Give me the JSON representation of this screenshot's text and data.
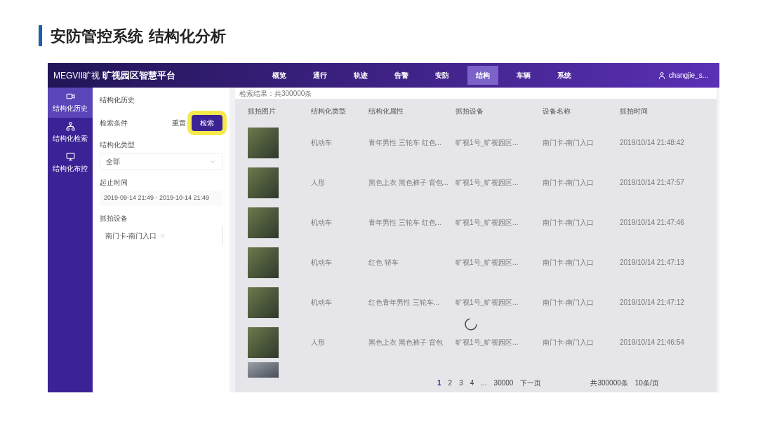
{
  "slide_title": "安防管控系统 结构化分析",
  "app": {
    "logo": "MEGVII旷视",
    "name": "旷视园区智慧平台",
    "user": "changjie_s...",
    "nav": [
      {
        "label": "概览",
        "selected": false
      },
      {
        "label": "通行",
        "selected": false
      },
      {
        "label": "轨迹",
        "selected": false
      },
      {
        "label": "告警",
        "selected": false
      },
      {
        "label": "安防",
        "selected": false
      },
      {
        "label": "结构",
        "selected": true
      },
      {
        "label": "车辆",
        "selected": false
      },
      {
        "label": "系统",
        "selected": false
      }
    ]
  },
  "sidebar": [
    {
      "label": "结构化历史",
      "selected": true
    },
    {
      "label": "结构化检索",
      "selected": false
    },
    {
      "label": "结构化布控",
      "selected": false
    }
  ],
  "filter": {
    "title": "结构化历史",
    "conditions_label": "检索条件",
    "reset": "重置",
    "search": "检索",
    "fields": [
      {
        "kind": "select",
        "label": "结构化类型",
        "value": "全部"
      },
      {
        "kind": "range",
        "label": "起止时间",
        "value": "2019-09-14 21:49 - 2019-10-14 21:49"
      },
      {
        "kind": "tags",
        "label": "抓拍设备",
        "value": "南门卡-南门入口"
      }
    ]
  },
  "results": {
    "summary": "检索结果：共300000条",
    "columns": [
      "抓拍图片",
      "结构化类型",
      "结构化属性",
      "抓拍设备",
      "设备名称",
      "抓拍时间"
    ],
    "rows": [
      {
        "type": "机动车",
        "attribute": "青年男性 三轮车 红色...",
        "location": "旷视1号_旷视园区...",
        "device": "南门卡-南门入口",
        "time": "2019/10/14 21:48:42"
      },
      {
        "type": "人形",
        "attribute": "黑色上衣 黑色裤子 背包...",
        "location": "旷视1号_旷视园区...",
        "device": "南门卡-南门入口",
        "time": "2019/10/14 21:47:57"
      },
      {
        "type": "机动车",
        "attribute": "青年男性 三轮车 红色...",
        "location": "旷视1号_旷视园区...",
        "device": "南门卡-南门入口",
        "time": "2019/10/14 21:47:46"
      },
      {
        "type": "机动车",
        "attribute": "红色 轿车",
        "location": "旷视1号_旷视园区...",
        "device": "南门卡-南门入口",
        "time": "2019/10/14 21:47:13"
      },
      {
        "type": "机动车",
        "attribute": "红色青年男性 三轮车...",
        "location": "旷视1号_旷视园区...",
        "device": "南门卡-南门入口",
        "time": "2019/10/14 21:47:12"
      },
      {
        "type": "人形",
        "attribute": "黑色上衣 黑色裤子 背包",
        "location": "旷视1号_旷视园区...",
        "device": "南门卡-南门入口",
        "time": "2019/10/14 21:46:54"
      }
    ],
    "pagination": {
      "pages": [
        {
          "label": "1",
          "selected": true
        },
        {
          "label": "2",
          "selected": false
        },
        {
          "label": "3",
          "selected": false
        },
        {
          "label": "4",
          "selected": false
        },
        {
          "label": "...",
          "selected": false
        },
        {
          "label": "30000",
          "selected": false
        }
      ],
      "next": "下一页",
      "total": "共300000条",
      "page_size": "10条/页"
    }
  }
}
